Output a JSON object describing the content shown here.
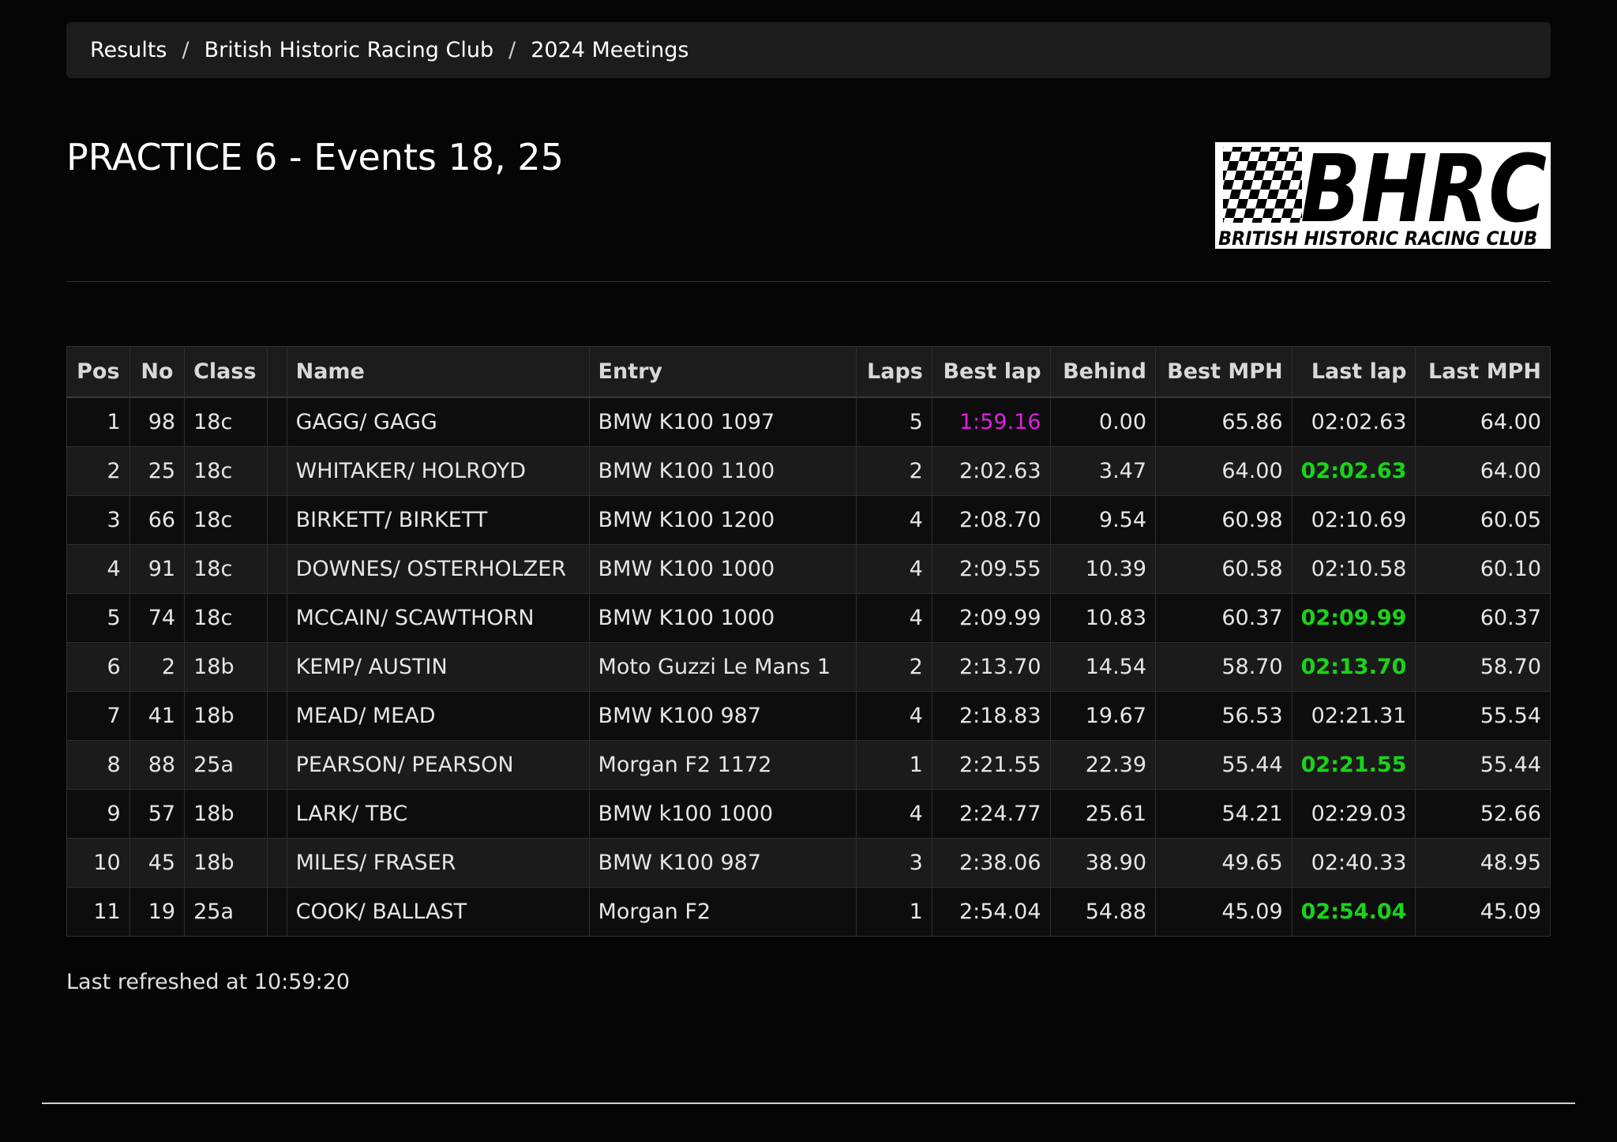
{
  "breadcrumb": {
    "items": [
      "Results",
      "British Historic Racing Club",
      "2024 Meetings"
    ],
    "separator": "/"
  },
  "page_title": "PRACTICE 6 - Events 18, 25",
  "logo": {
    "big_text": "BHRC",
    "sub_text": "BRITISH HISTORIC RACING CLUB"
  },
  "colors": {
    "best_overall": "#e020e0",
    "personal_best": "#19d419"
  },
  "table": {
    "headers": [
      "Pos",
      "No",
      "Class",
      "",
      "Name",
      "Entry",
      "Laps",
      "Best lap",
      "Behind",
      "Best MPH",
      "Last lap",
      "Last MPH"
    ],
    "rows": [
      [
        "1",
        "98",
        "18c",
        "",
        "GAGG/ GAGG",
        "BMW K100 1097",
        "5",
        "1:59.16",
        "0.00",
        "65.86",
        "02:02.63",
        "64.00"
      ],
      [
        "2",
        "25",
        "18c",
        "",
        "WHITAKER/ HOLROYD",
        "BMW K100 1100",
        "2",
        "2:02.63",
        "3.47",
        "64.00",
        "02:02.63",
        "64.00"
      ],
      [
        "3",
        "66",
        "18c",
        "",
        "BIRKETT/ BIRKETT",
        "BMW K100 1200",
        "4",
        "2:08.70",
        "9.54",
        "60.98",
        "02:10.69",
        "60.05"
      ],
      [
        "4",
        "91",
        "18c",
        "",
        "DOWNES/ OSTERHOLZER",
        "BMW K100 1000",
        "4",
        "2:09.55",
        "10.39",
        "60.58",
        "02:10.58",
        "60.10"
      ],
      [
        "5",
        "74",
        "18c",
        "",
        "MCCAIN/ SCAWTHORN",
        "BMW K100 1000",
        "4",
        "2:09.99",
        "10.83",
        "60.37",
        "02:09.99",
        "60.37"
      ],
      [
        "6",
        "2",
        "18b",
        "",
        "KEMP/ AUSTIN",
        "Moto Guzzi Le Mans 1",
        "2",
        "2:13.70",
        "14.54",
        "58.70",
        "02:13.70",
        "58.70"
      ],
      [
        "7",
        "41",
        "18b",
        "",
        "MEAD/ MEAD",
        "BMW K100 987",
        "4",
        "2:18.83",
        "19.67",
        "56.53",
        "02:21.31",
        "55.54"
      ],
      [
        "8",
        "88",
        "25a",
        "",
        "PEARSON/ PEARSON",
        "Morgan F2 1172",
        "1",
        "2:21.55",
        "22.39",
        "55.44",
        "02:21.55",
        "55.44"
      ],
      [
        "9",
        "57",
        "18b",
        "",
        "LARK/ TBC",
        "BMW k100 1000",
        "4",
        "2:24.77",
        "25.61",
        "54.21",
        "02:29.03",
        "52.66"
      ],
      [
        "10",
        "45",
        "18b",
        "",
        "MILES/ FRASER",
        "BMW K100 987",
        "3",
        "2:38.06",
        "38.90",
        "49.65",
        "02:40.33",
        "48.95"
      ],
      [
        "11",
        "19",
        "25a",
        "",
        "COOK/ BALLAST",
        "Morgan F2",
        "1",
        "2:54.04",
        "54.88",
        "45.09",
        "02:54.04",
        "45.09"
      ]
    ],
    "highlights": {
      "best_overall_cells": [
        [
          0,
          7
        ]
      ],
      "personal_best_cells": [
        [
          1,
          10
        ],
        [
          4,
          10
        ],
        [
          5,
          10
        ],
        [
          7,
          10
        ],
        [
          10,
          10
        ]
      ]
    }
  },
  "footer": {
    "last_refreshed": "Last refreshed at 10:59:20"
  }
}
